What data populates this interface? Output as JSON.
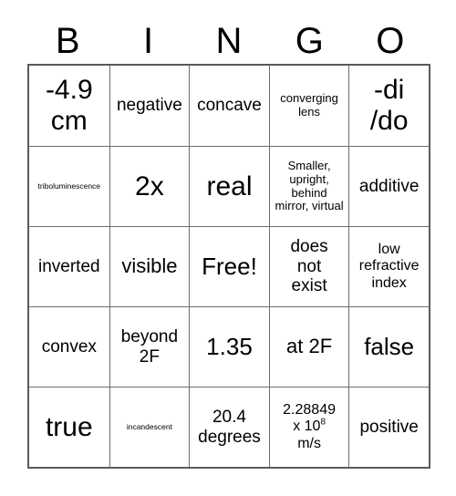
{
  "header": {
    "letters": [
      "B",
      "I",
      "N",
      "G",
      "O"
    ]
  },
  "grid": {
    "rows": [
      [
        {
          "text": "-4.9\ncm",
          "size": "xxl"
        },
        {
          "text": "negative",
          "size": "md"
        },
        {
          "text": "concave",
          "size": "md"
        },
        {
          "text": "converging\nlens",
          "size": "xs"
        },
        {
          "text": "-di\n/do",
          "size": "xxl"
        }
      ],
      [
        {
          "text": "triboluminescence",
          "size": "xxs"
        },
        {
          "text": "2x",
          "size": "xxl"
        },
        {
          "text": "real",
          "size": "xxl"
        },
        {
          "text": "Smaller,\nupright,\nbehind\nmirror, virtual",
          "size": "xs"
        },
        {
          "text": "additive",
          "size": "md"
        }
      ],
      [
        {
          "text": "inverted",
          "size": "md"
        },
        {
          "text": "visible",
          "size": "lg"
        },
        {
          "text": "Free!",
          "size": "xl"
        },
        {
          "text": "does\nnot\nexist",
          "size": "md"
        },
        {
          "text": "low\nrefractive\nindex",
          "size": "sm"
        }
      ],
      [
        {
          "text": "convex",
          "size": "md"
        },
        {
          "text": "beyond\n2F",
          "size": "md"
        },
        {
          "text": "1.35",
          "size": "xl"
        },
        {
          "text": "at 2F",
          "size": "lg"
        },
        {
          "text": "false",
          "size": "xl"
        }
      ],
      [
        {
          "text": "true",
          "size": "xxl"
        },
        {
          "text": "incandescent",
          "size": "xxs"
        },
        {
          "text": "20.4\ndegrees",
          "size": "md"
        },
        {
          "text": "2.28849\nx 10{SUP:8}\nm/s",
          "size": "sm"
        },
        {
          "text": "positive",
          "size": "md"
        }
      ]
    ]
  }
}
